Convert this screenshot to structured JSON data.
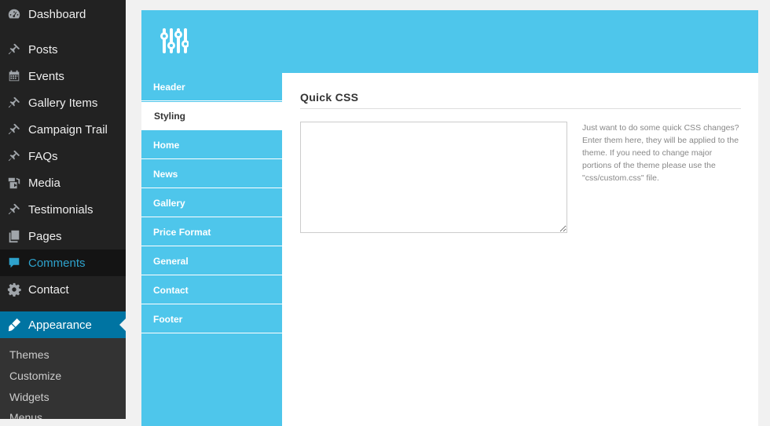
{
  "admin_menu": {
    "items": [
      {
        "label": "Dashboard",
        "icon": "dashboard-icon"
      },
      {
        "label": "Posts",
        "icon": "pin-icon"
      },
      {
        "label": "Events",
        "icon": "calendar-icon"
      },
      {
        "label": "Gallery Items",
        "icon": "pin-icon"
      },
      {
        "label": "Campaign Trail",
        "icon": "pin-icon"
      },
      {
        "label": "FAQs",
        "icon": "pin-icon"
      },
      {
        "label": "Media",
        "icon": "media-icon"
      },
      {
        "label": "Testimonials",
        "icon": "pin-icon"
      },
      {
        "label": "Pages",
        "icon": "pages-icon"
      },
      {
        "label": "Comments",
        "icon": "comment-icon"
      },
      {
        "label": "Contact",
        "icon": "gear-icon"
      },
      {
        "label": "Appearance",
        "icon": "brush-icon"
      }
    ],
    "submenu": [
      "Themes",
      "Customize",
      "Widgets",
      "Menus"
    ]
  },
  "options_panel": {
    "header_icon": "sliders-icon",
    "tabs": [
      "Header",
      "Styling",
      "Home",
      "News",
      "Gallery",
      "Price Format",
      "General",
      "Contact",
      "Footer"
    ],
    "active_tab": "Styling",
    "section_title": "Quick CSS",
    "textarea_value": "",
    "description": "Just want to do some quick CSS changes? Enter them here, they will be applied to the theme. If you need to change major portions of the theme please use the \"css/custom.css\" file."
  },
  "colors": {
    "accent": "#4ec6eb",
    "admin_sidebar": "#222222",
    "admin_active": "#0074a2",
    "admin_highlight": "#2ea2cc"
  }
}
